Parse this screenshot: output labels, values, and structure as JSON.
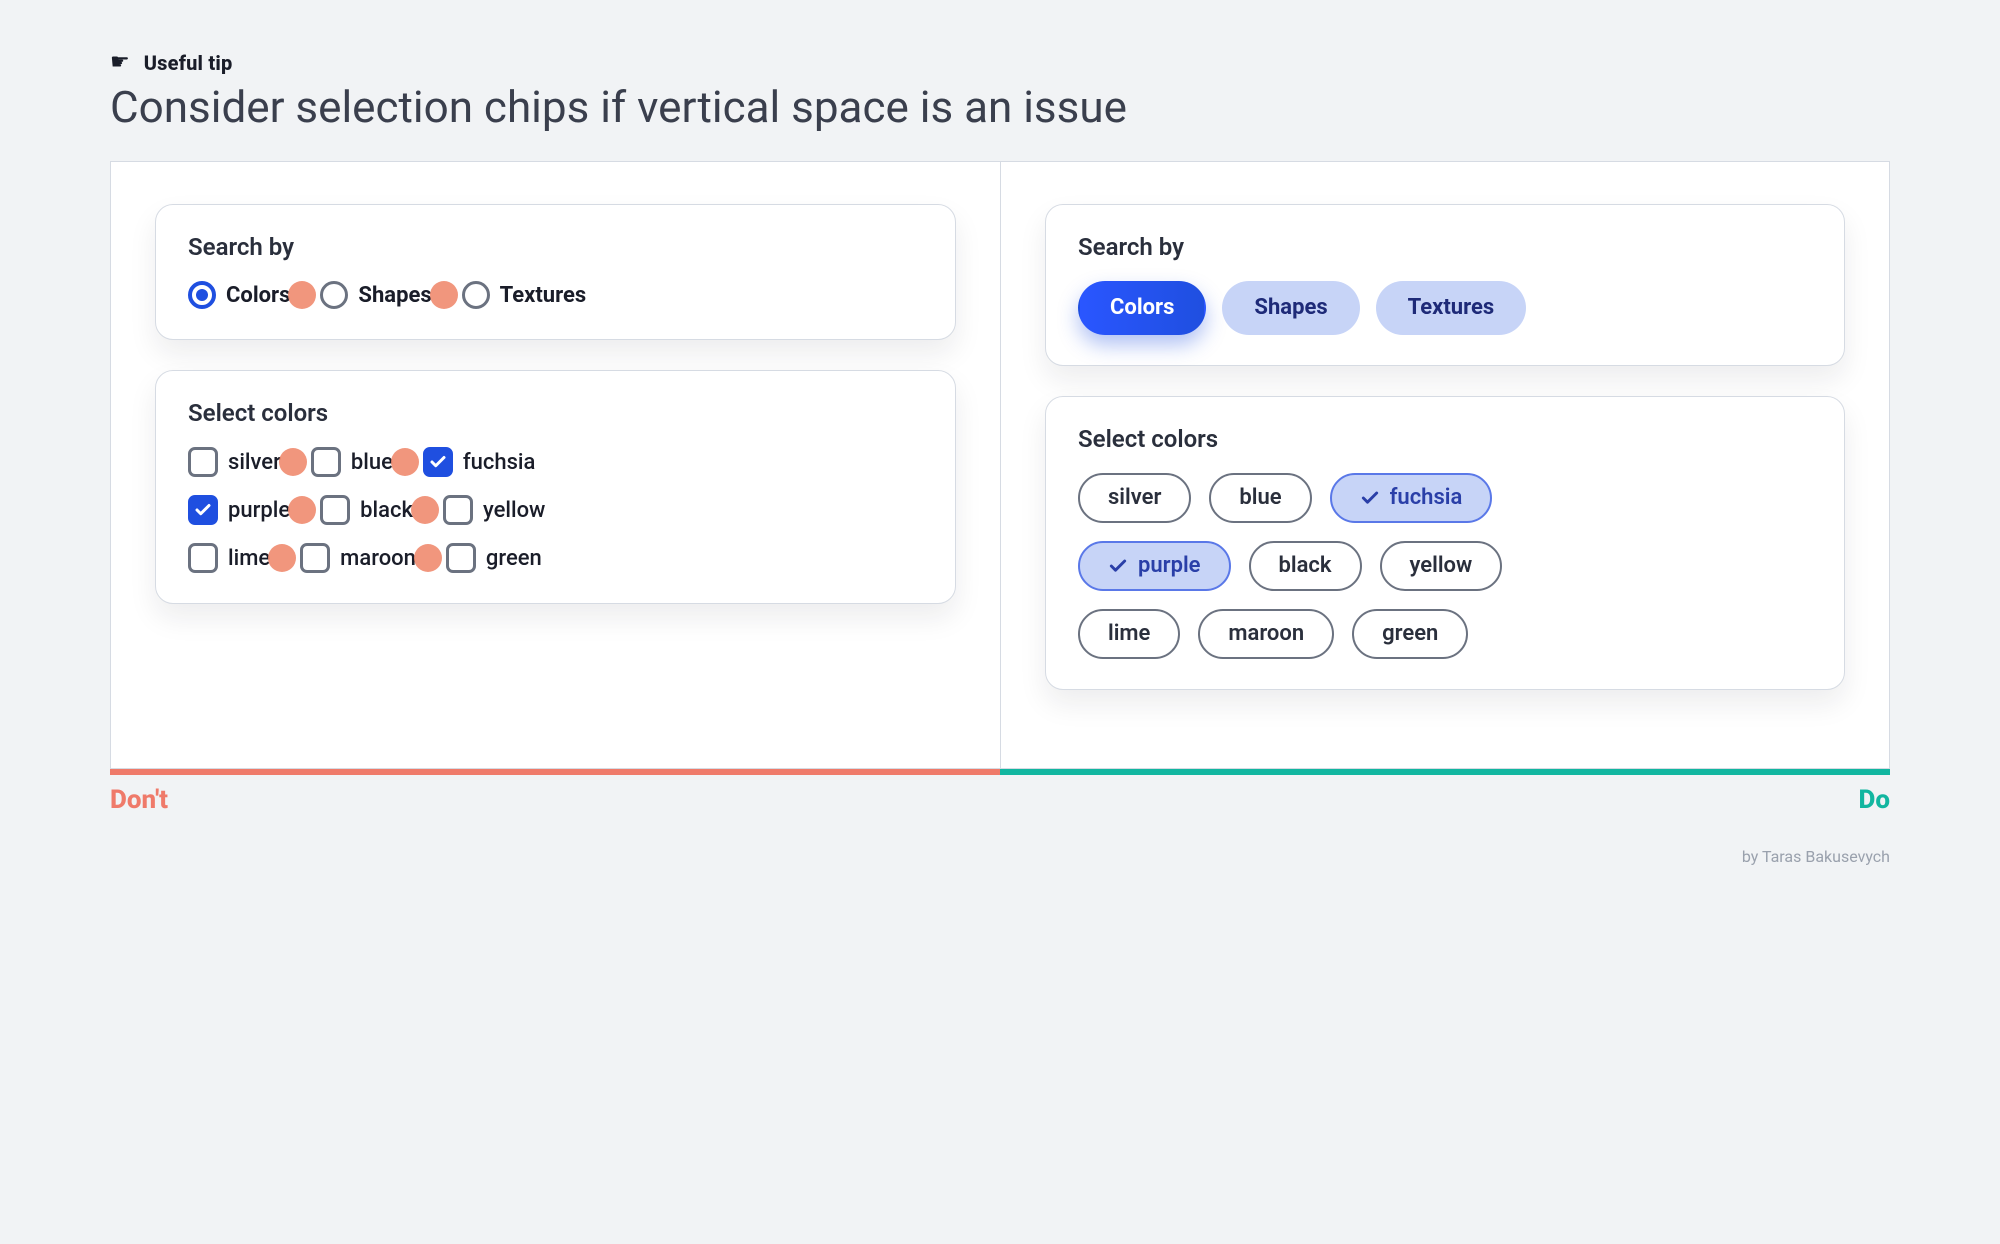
{
  "tip": {
    "label": "Useful tip"
  },
  "headline": "Consider selection chips if vertical space is an issue",
  "dont": {
    "searchBy": {
      "title": "Search by",
      "options": [
        "Colors",
        "Shapes",
        "Textures"
      ],
      "selectedIndex": 0
    },
    "selectColors": {
      "title": "Select colors",
      "items": [
        {
          "label": "silver",
          "checked": false
        },
        {
          "label": "blue",
          "checked": false
        },
        {
          "label": "fuchsia",
          "checked": true
        },
        {
          "label": "purple",
          "checked": true
        },
        {
          "label": "black",
          "checked": false
        },
        {
          "label": "yellow",
          "checked": false
        },
        {
          "label": "lime",
          "checked": false
        },
        {
          "label": "maroon",
          "checked": false
        },
        {
          "label": "green",
          "checked": false
        }
      ]
    },
    "label": "Don't"
  },
  "do": {
    "searchBy": {
      "title": "Search by",
      "options": [
        "Colors",
        "Shapes",
        "Textures"
      ],
      "selectedIndex": 0
    },
    "selectColors": {
      "title": "Select colors",
      "items": [
        {
          "label": "silver",
          "selected": false
        },
        {
          "label": "blue",
          "selected": false
        },
        {
          "label": "fuchsia",
          "selected": true
        },
        {
          "label": "purple",
          "selected": true
        },
        {
          "label": "black",
          "selected": false
        },
        {
          "label": "yellow",
          "selected": false
        },
        {
          "label": "lime",
          "selected": false
        },
        {
          "label": "maroon",
          "selected": false
        },
        {
          "label": "green",
          "selected": false
        }
      ]
    },
    "label": "Do"
  },
  "attribution": "by Taras Bakusevych"
}
